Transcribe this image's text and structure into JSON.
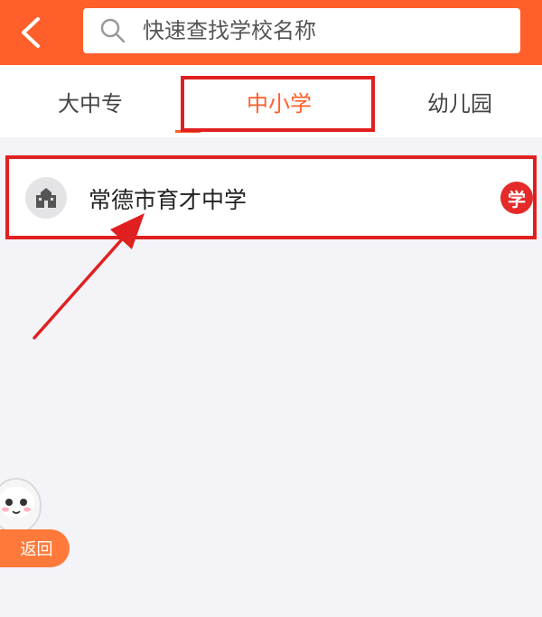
{
  "header": {
    "back_icon": "chevron-left-icon",
    "search": {
      "placeholder": "快速查找学校名称",
      "value": "",
      "icon": "search-icon"
    }
  },
  "tabs": [
    {
      "label": "大中专",
      "active": false
    },
    {
      "label": "中小学",
      "active": true
    },
    {
      "label": "幼儿园",
      "active": false
    }
  ],
  "schools": [
    {
      "name": "常德市育才中学",
      "icon": "school-building-icon",
      "badge": "学"
    }
  ],
  "floating": {
    "return_label": "返回"
  },
  "colors": {
    "brand": "#ff5f2a",
    "annotation": "#e02020",
    "badge": "#e52a2a"
  }
}
